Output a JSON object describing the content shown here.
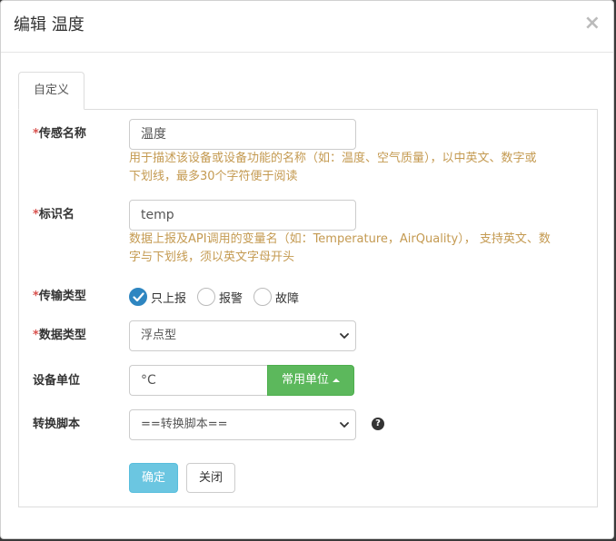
{
  "dialog": {
    "title": "编辑 温度",
    "close_glyph": "×"
  },
  "tab": {
    "label": "自定义"
  },
  "form": {
    "required_mark": "*",
    "sensor_name": {
      "label": "传感名称",
      "value": "温度",
      "help": [
        "用于描述该设备或设备功能的名称（如：温度、空气质量），以中英文、数字或",
        "下划线，最多30个字符便于阅读"
      ]
    },
    "identifier": {
      "label": "标识名",
      "value": "temp",
      "help": [
        "数据上报及API调用的变量名（如：Temperature，AirQuality）， 支持英文、数",
        "字与下划线，须以英文字母开头"
      ]
    },
    "transfer_type": {
      "label": "传输类型",
      "options": [
        {
          "label": "只上报",
          "checked": true
        },
        {
          "label": "报警",
          "checked": false
        },
        {
          "label": "故障",
          "checked": false
        }
      ]
    },
    "data_type": {
      "label": "数据类型",
      "selected": "浮点型"
    },
    "unit": {
      "label": "设备单位",
      "value": "°C",
      "button_label": "常用单位"
    },
    "script": {
      "label": "转换脚本",
      "selected": "==转换脚本=="
    }
  },
  "buttons": {
    "ok": "确定",
    "close": "关闭"
  },
  "colors": {
    "help_text": "#c49a51",
    "required": "#d9534f",
    "radio_checked": "#2e86c1",
    "unit_button": "#5cb85c",
    "ok_button": "#5bc0de"
  },
  "icons": {
    "checked_radio": "check-icon",
    "unit_dropdown": "caret-up-icon",
    "select_dropdown": "chevron-down-icon",
    "help": "question-circle-icon"
  }
}
